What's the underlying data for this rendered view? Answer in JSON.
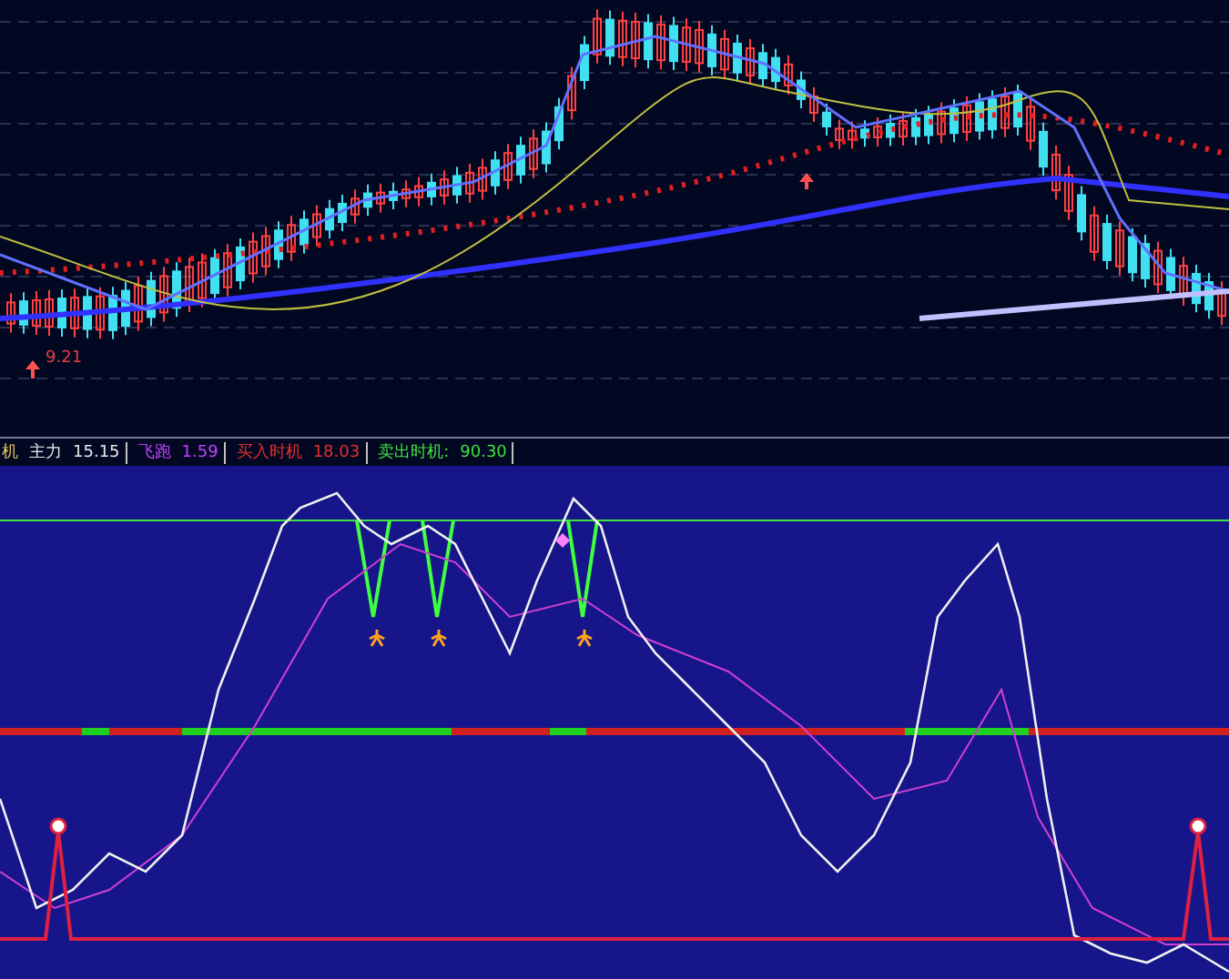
{
  "price_chart": {
    "price_label": "9.21"
  },
  "indicator_bar": {
    "name": "机",
    "items": [
      {
        "label": "主力",
        "value": "15.15",
        "color": "#e8e8e8"
      },
      {
        "label": "飞跑",
        "value": "1.59",
        "color": "#c040ff"
      },
      {
        "label": "买入时机",
        "value": "18.03",
        "color": "#e03030"
      },
      {
        "label": "卖出时机:",
        "value": "90.30",
        "color": "#40e040"
      }
    ]
  }
}
